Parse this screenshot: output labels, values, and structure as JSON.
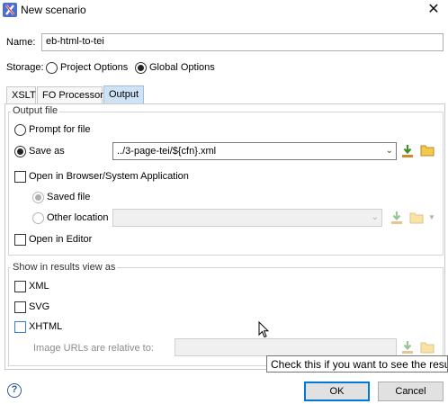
{
  "window": {
    "title": "New scenario"
  },
  "name_field": {
    "label": "Name:",
    "value": "eb-html-to-tei"
  },
  "storage": {
    "label": "Storage:",
    "options": [
      "Project Options",
      "Global Options"
    ],
    "selected": "Global Options"
  },
  "tabs": [
    {
      "label": "XSLT",
      "active": false
    },
    {
      "label": "FO Processor",
      "active": false
    },
    {
      "label": "Output",
      "active": true
    }
  ],
  "output_file": {
    "legend": "Output file",
    "prompt_label": "Prompt for file",
    "save_as_label": "Save as",
    "save_as_value": "../3-page-tei/${cfn}.xml",
    "open_browser_label": "Open in Browser/System Application",
    "saved_file_label": "Saved file",
    "other_location_label": "Other location",
    "open_editor_label": "Open in Editor"
  },
  "results_view": {
    "legend": "Show in results view as",
    "xml_label": "XML",
    "svg_label": "SVG",
    "xhtml_label": "XHTML",
    "image_urls_label": "Image URLs are relative to:"
  },
  "tooltip": {
    "text": "Check this if you want to see the resul"
  },
  "buttons": {
    "ok": "OK",
    "cancel": "Cancel",
    "help": "?"
  },
  "colors": {
    "active_tab": "#cfe3f7",
    "default_button_border": "#0078d7",
    "xhtml_checkbox_border": "#3a7bd5"
  },
  "icons": [
    "app-x-icon",
    "close-icon",
    "insert-editor-variable-icon",
    "browse-folder-icon",
    "help-icon",
    "mouse-cursor-icon"
  ]
}
